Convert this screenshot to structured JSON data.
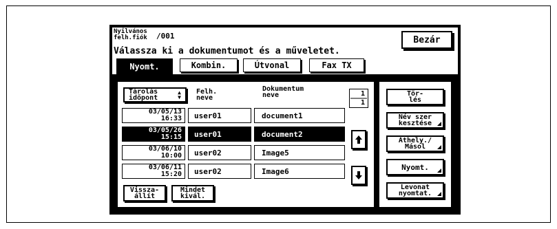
{
  "header": {
    "account_line1": "Nyilvános",
    "account_line2": "felh.fiók",
    "account_number": "/001",
    "message": "Válassza ki a dokumentumot és a műveletet.",
    "close_label": "Bezár"
  },
  "tabs": [
    {
      "label": "Nyomt.",
      "active": true
    },
    {
      "label": "Kombin.",
      "active": false
    },
    {
      "label": "Útvonal",
      "active": false
    },
    {
      "label": "Fax TX",
      "active": false
    }
  ],
  "list": {
    "sort_button": "Tárolás\nidőpont",
    "col_user": "Felh.\nneve",
    "col_document": "Dokumentum\nneve",
    "page_current": "1",
    "page_total": "1",
    "rows": [
      {
        "date": "03/05/13",
        "time": "16:33",
        "user": "user01",
        "document": "document1",
        "selected": false
      },
      {
        "date": "03/05/26",
        "time": "15:15",
        "user": "user01",
        "document": "document2",
        "selected": true
      },
      {
        "date": "03/06/10",
        "time": "10:00",
        "user": "user02",
        "document": "Image5",
        "selected": false
      },
      {
        "date": "03/06/11",
        "time": "15:20",
        "user": "user02",
        "document": "Image6",
        "selected": false
      }
    ],
    "reset_button": "Vissza-\nállít",
    "select_all_button": "Mindet\nkivál."
  },
  "actions": {
    "delete": "Tör-\nlés",
    "rename": "Név szer\nkesztése",
    "move_copy": "Áthely./\nMásol",
    "print": "Nyomt.",
    "print_deduct": "Levonat\nnyomtat."
  }
}
